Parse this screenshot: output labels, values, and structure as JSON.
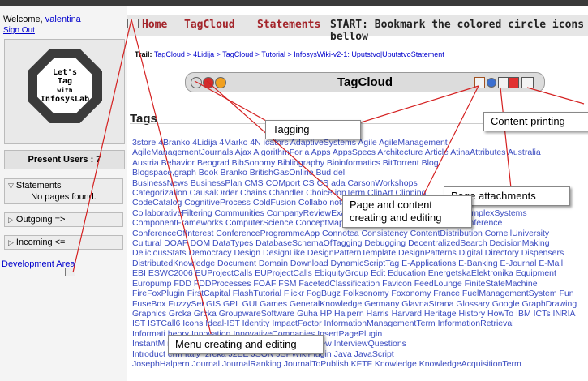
{
  "sidebar": {
    "welcome_prefix": "Welcome, ",
    "username": "valentina",
    "signout": "Sign Out",
    "logo_lines": [
      "Let's",
      "Tag",
      "with",
      "InfosysLab"
    ],
    "present_users": "Present Users : 7",
    "statements_label": "Statements",
    "statements_body": "No pages found.",
    "outgoing_label": "Outgoing =>",
    "incoming_label": "Incoming <=",
    "devarea": "Development Area"
  },
  "menu": {
    "home": "Home",
    "tagcloud": "TagCloud",
    "statements": "Statements",
    "start": "START: Bookmark the colored circle icons bellow"
  },
  "trail": {
    "label": "Trail:",
    "path": "TagCloud > 4Lidija > TagCloud > Tutorial > InfosysWiki-v2-1: Uputstvo|UputstvoStatement"
  },
  "tagcloud": {
    "title": "TagCloud",
    "dot_colors": [
      "#d9d9d9",
      "#d22b2b",
      "#f0a020"
    ]
  },
  "tags": {
    "title": "Tags",
    "lines": [
      "3store 4Branko 4Lidija 4Marko 4N                          icators AdaptiveSystems Agile AgileManagement",
      "AgileManagementJournals Ajax AlgorithmFor       a Apps AppsSpecs Architecture Article AtinaAttributes Australia",
      "Austria Behavior Beograd BibSonomy Bibliography Bioinformatics BitTorrent Blog          ",
      "Blogspace,graph Book Branko BritishGasOnline Bud                                                      del",
      "BusinessNews BusinessPlan CMS COMport CS CS                               ada CarsonWorkshops",
      "Categorization CausalOrder Chains Chandler Choice                         ionTerm ClipArt Clipping",
      "CodeCatalog CognitiveProcess ColdFusion Collabo                          notation",
      "CollaborativeFiltering Communities CompanyReviewExample ComparisonCompetitors ComplexSystems",
      "ComponentFrameworks ComputerScience ConceptMaps ConceptualReferenceModel Conference",
      "ConferenceOfInterest ConferenceProgrammeApp Connotea Consistency ContentDistribution CornellUniversity",
      "Cultural DOAP DOM DataTypes DatabaseSchemaOfTagging Debugging DecentralizedSearch DecisionMaking",
      "DeliciousStats Democracy Design DesignLike DesignPatternTemplate DesignPatterns Digital Directory Dispensers",
      "DistributedKnowledge Document Domain Download DynamicScriptTag E-Applications E-Banking E-Journal E-Mail",
      "EBI ESWC2006 EUProjectCalls EUProjectCalls EbiquityGroup Edit Education EnergetskaElektronika Equipment",
      "Europump FDD FDDProcesses FOAF FSM FacetedClassification Favicon FeedLounge FiniteStateMachine",
      "FireFoxPlugin FirstCapital FlashTutorial Flickr FogBugz Folksonomy Foxonomy France FuelManagementSystem Fun",
      "FuseBox FuzzySet GIS GPL GUI Games GeneralKnowledge Germany GlavnaStrana Glossary Google GraphDrawing",
      "Graphics Grcka Grcka GroupwareSoftware Guha HP Halpern Harris Harvard Heritage History HowTo IBM ICTs INRIA",
      "IST ISTCall6 Icons Ideal-IST Identity ImpactFactor InformationManagementTerm InformationRetrieval",
      "Informati                                                          heory Innovation InnovativeCompanies InsertPagePlugin",
      "InstantM                                                           roup Internet InternetMathematics Interview InterviewQuestions",
      "Introduct                                                          erm Italy Izreka J2EE JSON JSPWikiPlugin Java JavaScript",
      "JosephHalpern Journal JournalRanking JournalToPublish KFTF Knowledge KnowledgeAcquisitionTerm"
    ]
  },
  "callouts": {
    "tagging": "Tagging",
    "content_printing": "Content printing",
    "page_attachments": "Page attachments",
    "page_content": "Page and content creating and editing",
    "menu_editing": "Menu creating and editing"
  }
}
